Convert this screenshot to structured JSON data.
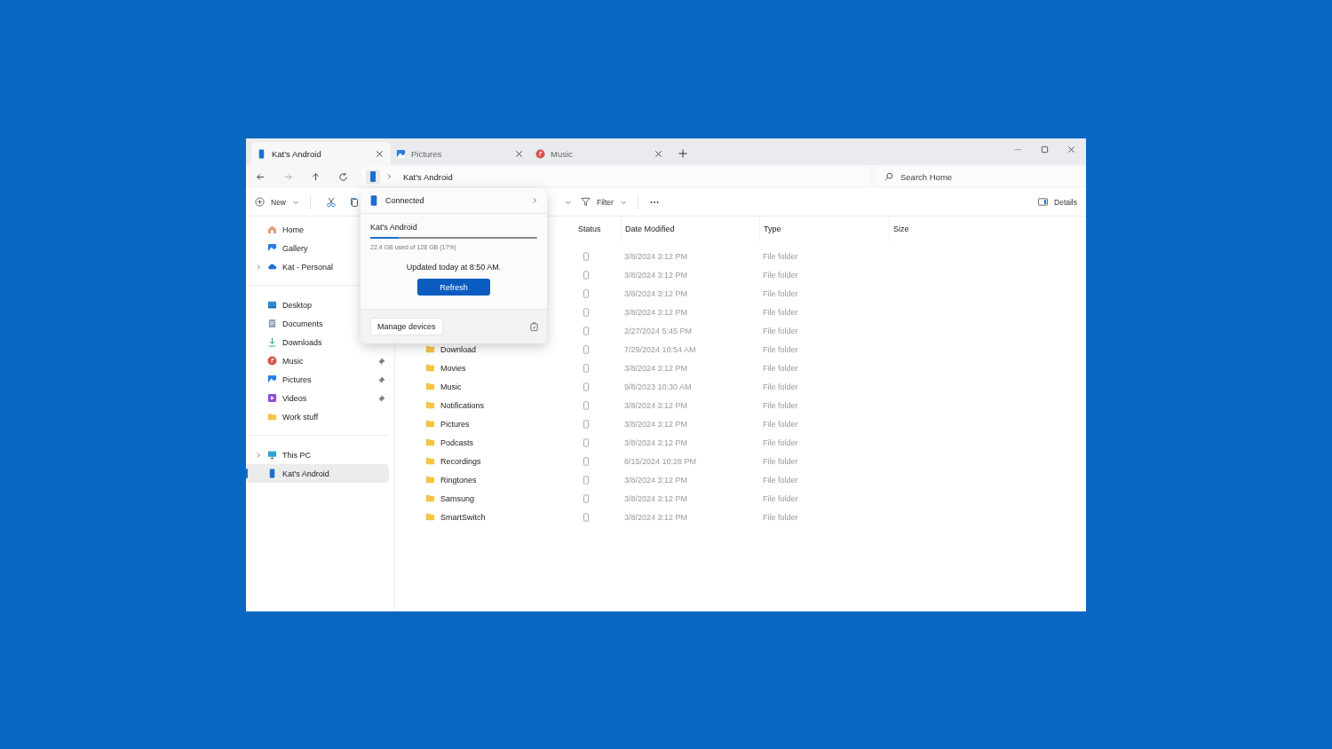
{
  "tabs": [
    {
      "label": "Kat's Android",
      "kind": "phone",
      "selected": true
    },
    {
      "label": "Pictures",
      "kind": "pictures",
      "selected": false
    },
    {
      "label": "Music",
      "kind": "music",
      "selected": false
    }
  ],
  "address": {
    "breadcrumb": "Kat's Android"
  },
  "search": {
    "placeholder": "Search Home"
  },
  "toolbar": {
    "new": "New",
    "filter": "Filter",
    "details": "Details"
  },
  "sidebar": {
    "groups": [
      {
        "items": [
          {
            "label": "Home",
            "kind": "home",
            "expandable": false,
            "selected": false
          },
          {
            "label": "Gallery",
            "kind": "gallery",
            "expandable": false,
            "selected": false
          },
          {
            "label": "Kat - Personal",
            "kind": "cloud",
            "expandable": true,
            "selected": false
          }
        ]
      },
      {
        "items": [
          {
            "label": "Desktop",
            "kind": "desktop",
            "expandable": false,
            "selected": false
          },
          {
            "label": "Documents",
            "kind": "documents",
            "expandable": false,
            "selected": false
          },
          {
            "label": "Downloads",
            "kind": "downloads",
            "expandable": false,
            "pinned": false,
            "selected": false
          },
          {
            "label": "Music",
            "kind": "music",
            "expandable": false,
            "pinned": true,
            "selected": false
          },
          {
            "label": "Pictures",
            "kind": "pictures",
            "expandable": false,
            "pinned": true,
            "selected": false
          },
          {
            "label": "Videos",
            "kind": "videos",
            "expandable": false,
            "pinned": true,
            "selected": false
          },
          {
            "label": "Work stuff",
            "kind": "folder",
            "expandable": false,
            "pinned": false,
            "selected": false
          }
        ]
      },
      {
        "items": [
          {
            "label": "This PC",
            "kind": "pc",
            "expandable": true,
            "pinned": false,
            "selected": false
          },
          {
            "label": "Kat's Android",
            "kind": "phone",
            "expandable": false,
            "pinned": false,
            "selected": true
          }
        ]
      }
    ]
  },
  "table": {
    "columns": [
      "Status",
      "Date Modified",
      "Type",
      "Size"
    ],
    "rows": [
      {
        "date": "3/8/2024 3:12 PM",
        "type": "File folder"
      },
      {
        "date": "3/8/2024 3:12 PM",
        "type": "File folder"
      },
      {
        "date": "3/8/2024 3:12 PM",
        "type": "File folder"
      },
      {
        "date": "3/8/2024 3:12 PM",
        "type": "File folder"
      },
      {
        "date": "2/27/2024 5:45 PM",
        "type": "File folder"
      },
      {
        "name": "Download",
        "date": "7/29/2024 10:54 AM",
        "type": "File folder"
      },
      {
        "name": "Movies",
        "date": "3/8/2024 3:12 PM",
        "type": "File folder"
      },
      {
        "name": "Music",
        "date": "9/8/2023 10:30 AM",
        "type": "File folder"
      },
      {
        "name": "Notifications",
        "date": "3/8/2024 3:12 PM",
        "type": "File folder"
      },
      {
        "name": "Pictures",
        "date": "3/8/2024 3:12 PM",
        "type": "File folder"
      },
      {
        "name": "Podcasts",
        "date": "3/8/2024 3:12 PM",
        "type": "File folder"
      },
      {
        "name": "Recordings",
        "date": "8/15/2024 10:28 PM",
        "type": "File folder"
      },
      {
        "name": "Ringtones",
        "date": "3/8/2024 3:12 PM",
        "type": "File folder"
      },
      {
        "name": "Samsung",
        "date": "3/8/2024 3:12 PM",
        "type": "File folder"
      },
      {
        "name": "SmartSwitch",
        "date": "3/8/2024 3:12 PM",
        "type": "File folder"
      }
    ]
  },
  "popup": {
    "status": "Connected",
    "device": "Kat's Android",
    "storage": {
      "level": 0.17,
      "text": "22.4 GB used of 128 GB (17%)"
    },
    "updated": "Updated today at 8:50 AM.",
    "refresh": "Refresh",
    "manage": "Manage devices"
  }
}
